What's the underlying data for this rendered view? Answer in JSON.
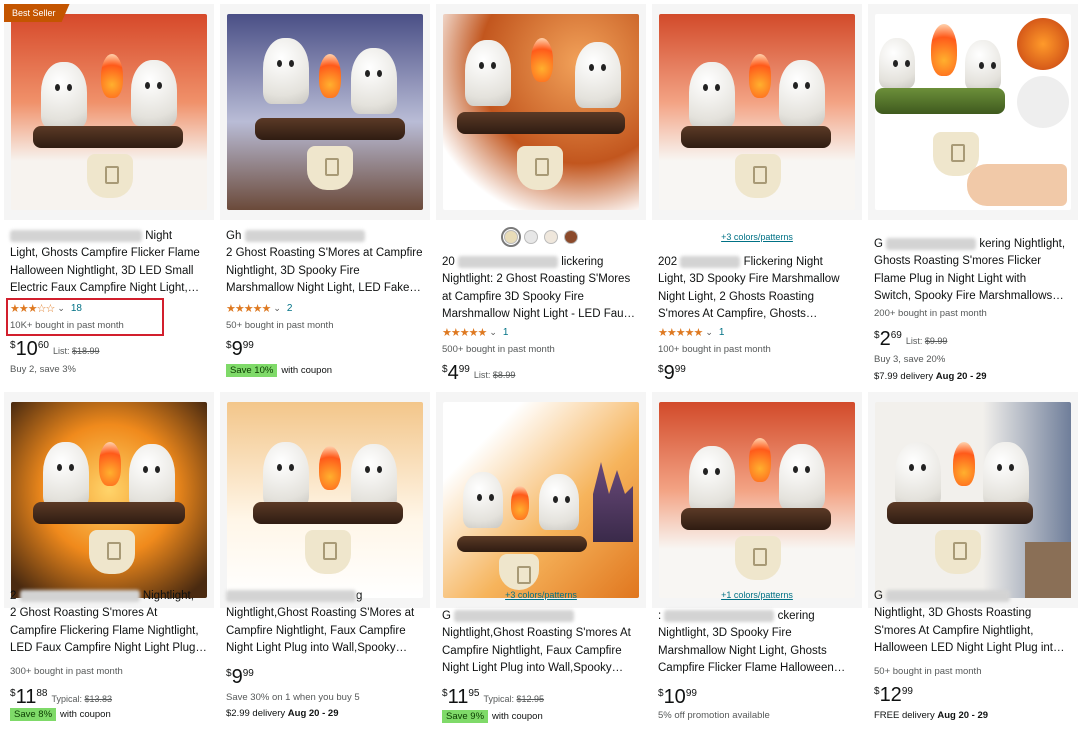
{
  "colors": {
    "accent_star": "#de7921",
    "link": "#007185",
    "badge": "#c45500",
    "coupon_green": "#7fda69",
    "highlight": "#d21f2d"
  },
  "products": [
    {
      "badge": "Best Seller",
      "title_lines": [
        "Night",
        "Light, Ghosts Campfire Flicker Flame",
        "Halloween Nightlight, 3D LED Small",
        "Electric Faux Campfire Night Light,…"
      ],
      "stars": "★★★☆☆",
      "reviews": "18",
      "bought": "10K+ bought in past month",
      "price": {
        "sym": "$",
        "whole": "10",
        "frac": "60"
      },
      "list": {
        "label": "List:",
        "value": "$18.99"
      },
      "extra": "Buy 2, save 3%"
    },
    {
      "title_lines": [
        "Gh",
        "2 Ghost Roasting S'Mores at Campfire",
        "Nightlight, 3D Spooky Fire",
        "Marshmallow Night Light, LED Fake…"
      ],
      "stars": "★★★★★",
      "reviews": "2",
      "bought": "50+ bought in past month",
      "price": {
        "sym": "$",
        "whole": "9",
        "frac": "99"
      },
      "coupon": {
        "tag": "Save 10%",
        "text": "with coupon"
      }
    },
    {
      "title_lines": [
        "20",
        "lickering",
        "Nightlight: 2 Ghost Roasting S'Mores",
        "at Campfire 3D Spooky Fire",
        "Marshmallow Night Light - LED Fau…"
      ],
      "stars": "★★★★★",
      "reviews": "1",
      "bought": "500+ bought in past month",
      "price": {
        "sym": "$",
        "whole": "4",
        "frac": "99"
      },
      "list": {
        "label": "List:",
        "value": "$8.99"
      }
    },
    {
      "colors_link": "+3 colors/patterns",
      "title_lines": [
        "202",
        "Flickering Night",
        "Light, 3D Spooky Fire Marshmallow",
        "Night Light, 2 Ghosts Roasting",
        "S'mores At Campfire, Ghosts…"
      ],
      "stars": "★★★★★",
      "reviews": "1",
      "bought": "100+ bought in past month",
      "price": {
        "sym": "$",
        "whole": "9",
        "frac": "99"
      }
    },
    {
      "title_lines": [
        "G",
        "kering Nightlight,",
        "Ghosts Roasting S'mores Flicker",
        "Flame Plug in Night Light with",
        "Switch, Spooky Fire Marshmallows…"
      ],
      "bought": "200+ bought in past month",
      "price": {
        "sym": "$",
        "whole": "2",
        "frac": "69"
      },
      "list": {
        "label": "List:",
        "value": "$9.99"
      },
      "extra": "Buy 3, save 20%",
      "delivery": {
        "text": "$7.99 delivery",
        "date": "Aug 20 - 29"
      }
    },
    {
      "title_lines": [
        "2",
        "Nightlight,",
        "2 Ghost Roasting S'mores At",
        "Campfire Flickering Flame Nightlight,",
        "LED Faux Campfire Night Light Plug…"
      ],
      "bought": "300+ bought in past month",
      "price": {
        "sym": "$",
        "whole": "11",
        "frac": "88"
      },
      "list": {
        "label": "Typical:",
        "value": "$13.83"
      },
      "coupon": {
        "tag": "Save 8%",
        "text": "with coupon"
      }
    },
    {
      "title_lines": [
        "g",
        "Nightlight,Ghost Roasting S'Mores at",
        "Campfire Nightlight, Faux Campfire",
        "Night Light Plug into Wall,Spooky…"
      ],
      "price": {
        "sym": "$",
        "whole": "9",
        "frac": "99"
      },
      "extra": "Save 30% on 1 when you buy 5",
      "delivery": {
        "text": "$2.99 delivery",
        "date": "Aug 20 - 29"
      }
    },
    {
      "colors_link": "+3 colors/patterns",
      "title_lines": [
        "G",
        "Nightlight,Ghost Roasting S'mores At",
        "Campfire Nightlight, Faux Campfire",
        "Night Light Plug into Wall,Spooky…"
      ],
      "price": {
        "sym": "$",
        "whole": "11",
        "frac": "95"
      },
      "list": {
        "label": "Typical:",
        "value": "$12.95"
      },
      "coupon": {
        "tag": "Save 9%",
        "text": "with coupon"
      }
    },
    {
      "colors_link": "+1 colors/patterns",
      "title_lines": [
        ":",
        "ckering",
        "Nightlight, 3D Spooky Fire",
        "Marshmallow Night Light, Ghosts",
        "Campfire Flicker Flame Halloween…"
      ],
      "price": {
        "sym": "$",
        "whole": "10",
        "frac": "99"
      },
      "extra": "5% off promotion available"
    },
    {
      "title_lines": [
        "G",
        "Nightlight, 3D Ghosts Roasting",
        "S'mores At Campfire Nightlight,",
        "Halloween LED Night Light Plug int…"
      ],
      "bought": "50+ bought in past month",
      "price": {
        "sym": "$",
        "whole": "12",
        "frac": "99"
      },
      "delivery": {
        "text": "FREE delivery",
        "date": "Aug 20 - 29"
      }
    }
  ]
}
